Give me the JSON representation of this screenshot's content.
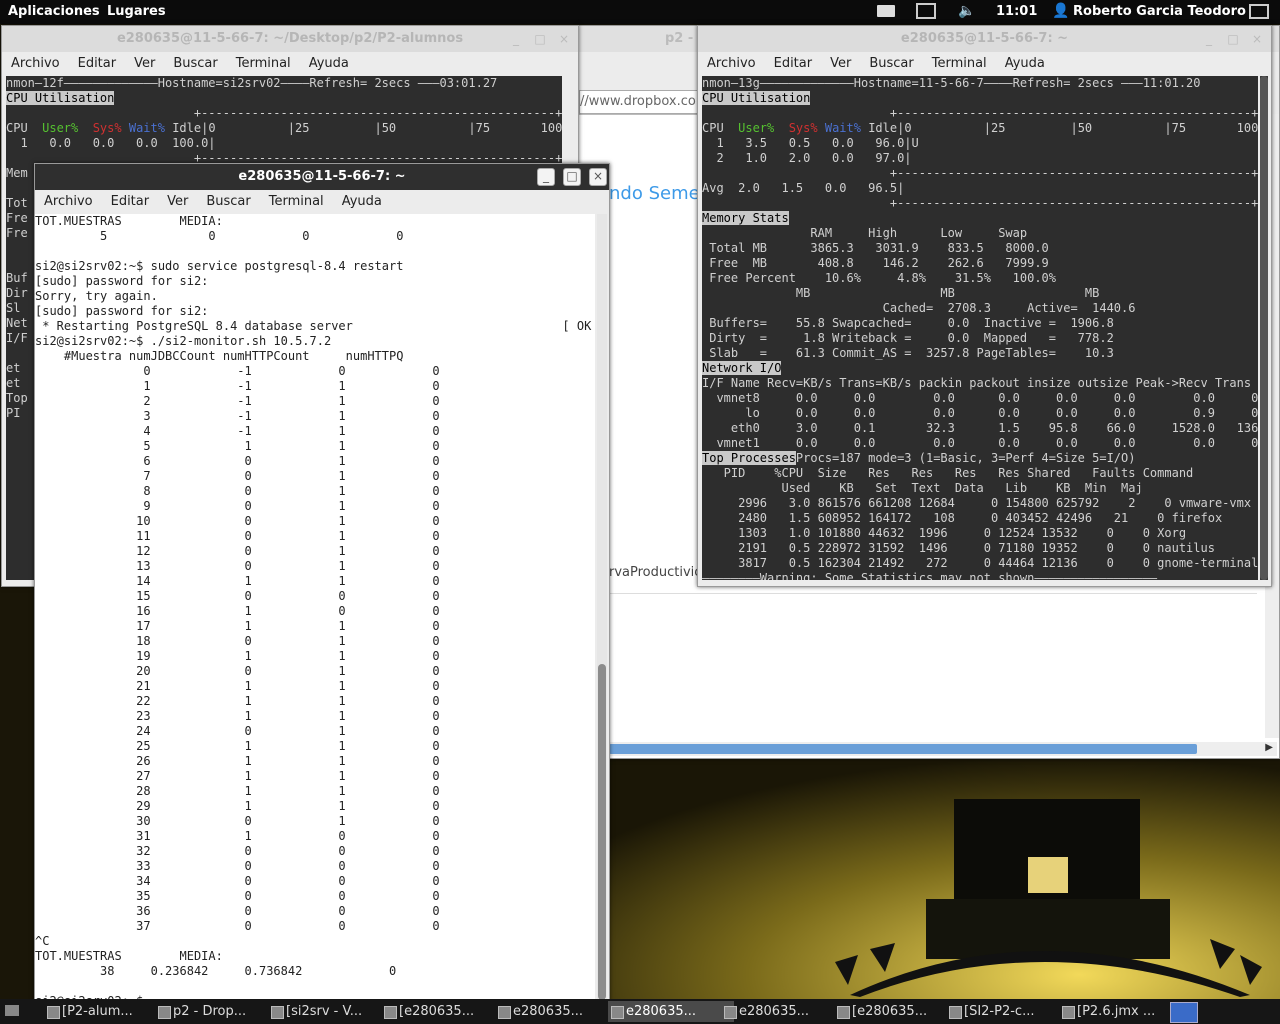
{
  "topbar": {
    "apps": "Aplicaciones",
    "places": "Lugares",
    "time": "11:01",
    "user": "Roberto Garcia Teodoro"
  },
  "browser": {
    "title": "p2 -",
    "url": "//www.dropbox.com",
    "text1": "ndo Semes",
    "text2": "rvaProductivic"
  },
  "back_term": {
    "title": "e280635@11-5-66-7: ~/Desktop/p2/P2-alumnos",
    "menu": [
      "Archivo",
      "Editar",
      "Ver",
      "Buscar",
      "Terminal",
      "Ayuda"
    ],
    "header": "nmon—12f—————————————Hostname=si2srv02————Refresh= 2secs ———03:01.27",
    "cpu_title": "CPU Utilisation",
    "lines": [
      "                          +-------------------------------------------------+",
      "CPU  User%  Sys% Wait% Idle|0          |25         |50          |75       100|",
      "  1   0.0   0.0   0.0  100.0|                                                 >",
      "                          +-------------------------------------------------+"
    ],
    "side": [
      "Mem",
      "",
      "Tot",
      "Fre",
      "Fre",
      "",
      "",
      "Buf",
      "Dir",
      "Sl",
      "Net",
      "I/F",
      "",
      "et",
      "et",
      "Top",
      "PI"
    ]
  },
  "front_term": {
    "title": "e280635@11-5-66-7: ~",
    "menu": [
      "Archivo",
      "Editar",
      "Ver",
      "Buscar",
      "Terminal",
      "Ayuda"
    ],
    "lines": [
      "TOT.MUESTRAS        MEDIA:",
      "         5              0            0            0",
      "",
      "si2@si2srv02:~$ sudo service postgresql-8.4 restart",
      "[sudo] password for si2:",
      "Sorry, try again.",
      "[sudo] password for si2:",
      " * Restarting PostgreSQL 8.4 database server                             [ OK ]",
      "si2@si2srv02:~$ ./si2-monitor.sh 10.5.7.2",
      "    #Muestra numJDBCCount numHTTPCount     numHTTPQ"
    ],
    "rows": [
      [
        0,
        -1,
        0,
        0
      ],
      [
        1,
        -1,
        1,
        0
      ],
      [
        2,
        -1,
        1,
        0
      ],
      [
        3,
        -1,
        1,
        0
      ],
      [
        4,
        -1,
        1,
        0
      ],
      [
        5,
        1,
        1,
        0
      ],
      [
        6,
        0,
        1,
        0
      ],
      [
        7,
        0,
        1,
        0
      ],
      [
        8,
        0,
        1,
        0
      ],
      [
        9,
        0,
        1,
        0
      ],
      [
        10,
        0,
        1,
        0
      ],
      [
        11,
        0,
        1,
        0
      ],
      [
        12,
        0,
        1,
        0
      ],
      [
        13,
        0,
        1,
        0
      ],
      [
        14,
        1,
        1,
        0
      ],
      [
        15,
        0,
        0,
        0
      ],
      [
        16,
        1,
        0,
        0
      ],
      [
        17,
        1,
        1,
        0
      ],
      [
        18,
        0,
        1,
        0
      ],
      [
        19,
        1,
        1,
        0
      ],
      [
        20,
        0,
        1,
        0
      ],
      [
        21,
        1,
        1,
        0
      ],
      [
        22,
        1,
        1,
        0
      ],
      [
        23,
        1,
        1,
        0
      ],
      [
        24,
        0,
        1,
        0
      ],
      [
        25,
        1,
        1,
        0
      ],
      [
        26,
        1,
        1,
        0
      ],
      [
        27,
        1,
        1,
        0
      ],
      [
        28,
        1,
        1,
        0
      ],
      [
        29,
        1,
        1,
        0
      ],
      [
        30,
        0,
        1,
        0
      ],
      [
        31,
        1,
        0,
        0
      ],
      [
        32,
        0,
        0,
        0
      ],
      [
        33,
        0,
        0,
        0
      ],
      [
        34,
        0,
        0,
        0
      ],
      [
        35,
        0,
        0,
        0
      ],
      [
        36,
        0,
        0,
        0
      ],
      [
        37,
        0,
        0,
        0
      ]
    ],
    "footer": [
      "^C",
      "TOT.MUESTRAS        MEDIA:",
      "         38     0.236842     0.736842            0",
      "",
      "si2@si2srv02:~$ "
    ]
  },
  "right_term": {
    "title": "e280635@11-5-66-7: ~",
    "menu": [
      "Archivo",
      "Editar",
      "Ver",
      "Buscar",
      "Terminal",
      "Ayuda"
    ],
    "header": "nmon—13g—————————————Hostname=11-5-66-7————Refresh= 2secs ———11:01.20",
    "cpu_title": "CPU Utilisation",
    "mem_title": "Memory Stats",
    "net_title": "Network I/O",
    "top_title": "Top Processes",
    "cpu_lines": [
      "                          +-------------------------------------------------+",
      "CPU  User%  Sys% Wait% Idle|0          |25         |50          |75       100|",
      "  1   3.5   0.5   0.0   96.0|U                                                >",
      "  2   1.0   2.0   0.0   97.0|                                                 >",
      "                          +-------------------------------------------------+",
      "Avg  2.0   1.5   0.0   96.5|                                                 >",
      "                          +-------------------------------------------------+"
    ],
    "mem_lines": [
      "               RAM     High      Low     Swap",
      " Total MB      3865.3   3031.9    833.5   8000.0",
      " Free  MB       408.8    146.2    262.6   7999.9",
      " Free Percent    10.6%     4.8%    31.5%   100.0%",
      "             MB                  MB                  MB",
      "                         Cached=  2708.3     Active=  1440.6",
      " Buffers=    55.8 Swapcached=     0.0  Inactive =  1906.8",
      " Dirty  =     1.8 Writeback =     0.0  Mapped   =   778.2",
      " Slab   =    61.3 Commit_AS =  3257.8 PageTables=    10.3"
    ],
    "net_lines": [
      "I/F Name Recv=KB/s Trans=KB/s packin packout insize outsize Peak->Recv Trans",
      "  vmnet8     0.0     0.0        0.0      0.0     0.0     0.0        0.0     0.0",
      "      lo     0.0     0.0        0.0      0.0     0.0     0.0        0.9     0.9",
      "    eth0     3.0     0.1       32.3      1.5    95.8    66.0     1528.0   136.9",
      "  vmnet1     0.0     0.0        0.0      0.0     0.0     0.0        0.0     0.0"
    ],
    "top_info": "Procs=187 mode=3 (1=Basic, 3=Perf 4=Size 5=I/O)",
    "top_lines": [
      "   PID    %CPU  Size   Res   Res   Res   Res Shared   Faults Command",
      "           Used    KB   Set  Text  Data   Lib    KB  Min  Maj",
      "     2996   3.0 861576 661208 12684     0 154800 625792    2    0 vmware-vmx",
      "     2480   1.5 608952 164172   108     0 403452 42496   21    0 firefox",
      "     1303   1.0 101880 44632  1996     0 12524 13532    0    0 Xorg",
      "     2191   0.5 228972 31592  1496     0 71180 19352    0    0 nautilus",
      "     3817   0.5 162304 21492   272     0 44464 12136    0    0 gnome-terminal"
    ],
    "warning": "————————Warning: Some Statistics may not shown—————————————————"
  },
  "taskbar": [
    "[P2-alum...",
    "p2 - Drop...",
    "[si2srv - V...",
    "[e280635...",
    "e280635...",
    "e280635...",
    "e280635...",
    "[e280635...",
    "[SI2-P2-c...",
    "[P2.6.jmx ..."
  ],
  "colors": {
    "terminal_bg": "#2d2d2d",
    "terminal_fg": "#d0d0d0",
    "user_green": "#55c030",
    "sys_red": "#d03030",
    "wait_blue": "#4a70d0"
  }
}
